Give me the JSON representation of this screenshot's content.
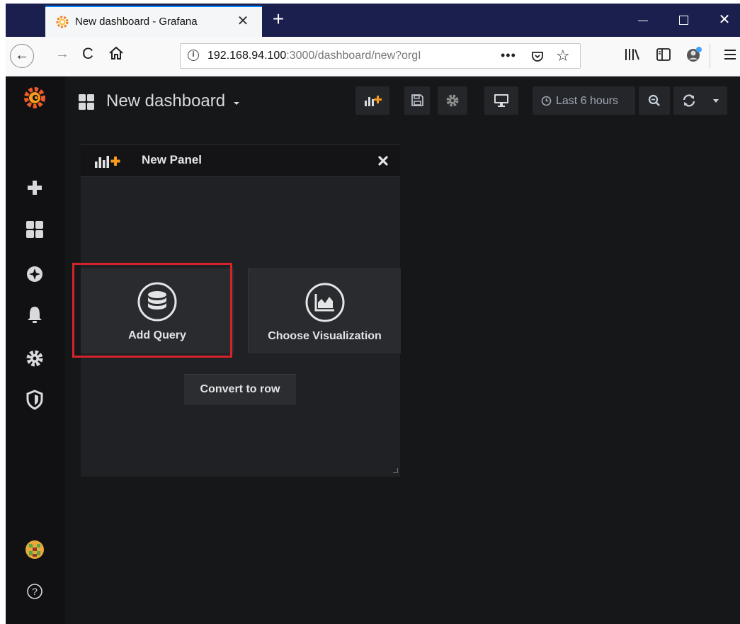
{
  "browser": {
    "tab_title": "New dashboard - Grafana",
    "tab_close_glyph": "✕",
    "new_tab_glyph": "+",
    "window_close_glyph": "✕",
    "back_glyph": "←",
    "forward_glyph": "→",
    "reload_glyph": "C",
    "url_host": "192.168.94.100",
    "url_rest": ":3000/dashboard/new?orgI",
    "url_info_glyph": "i",
    "page_actions_glyph": "•••",
    "bookmark_glyph": "☆",
    "icons": [
      "grafana-favicon",
      "home-icon",
      "pocket-icon",
      "library-icon",
      "sidebar-icon",
      "account-icon",
      "hamburger-menu-icon"
    ],
    "accent_color": "#0a84ff",
    "tab_strip_color": "#1b1f4d"
  },
  "grafana": {
    "dashboard_title": "New dashboard",
    "time_range_label": "Last 6 hours",
    "toolbar_icons": [
      "add-panel-icon",
      "save-icon",
      "settings-icon",
      "cycle-view-icon",
      "clock-icon",
      "zoom-out-icon",
      "refresh-icon"
    ],
    "side_menu_icons": [
      "grafana-logo-icon",
      "create-icon",
      "dashboards-icon",
      "explore-icon",
      "alerting-icon",
      "configuration-icon",
      "server-admin-icon",
      "user-avatar",
      "help-icon"
    ],
    "help_glyph": "?",
    "brand_color": "#f05a28",
    "background_color": "#161719"
  },
  "panel": {
    "title": "New Panel",
    "add_query_label": "Add Query",
    "choose_visualization_label": "Choose Visualization",
    "convert_to_row_label": "Convert to row",
    "highlight_color": "#d3242b"
  }
}
